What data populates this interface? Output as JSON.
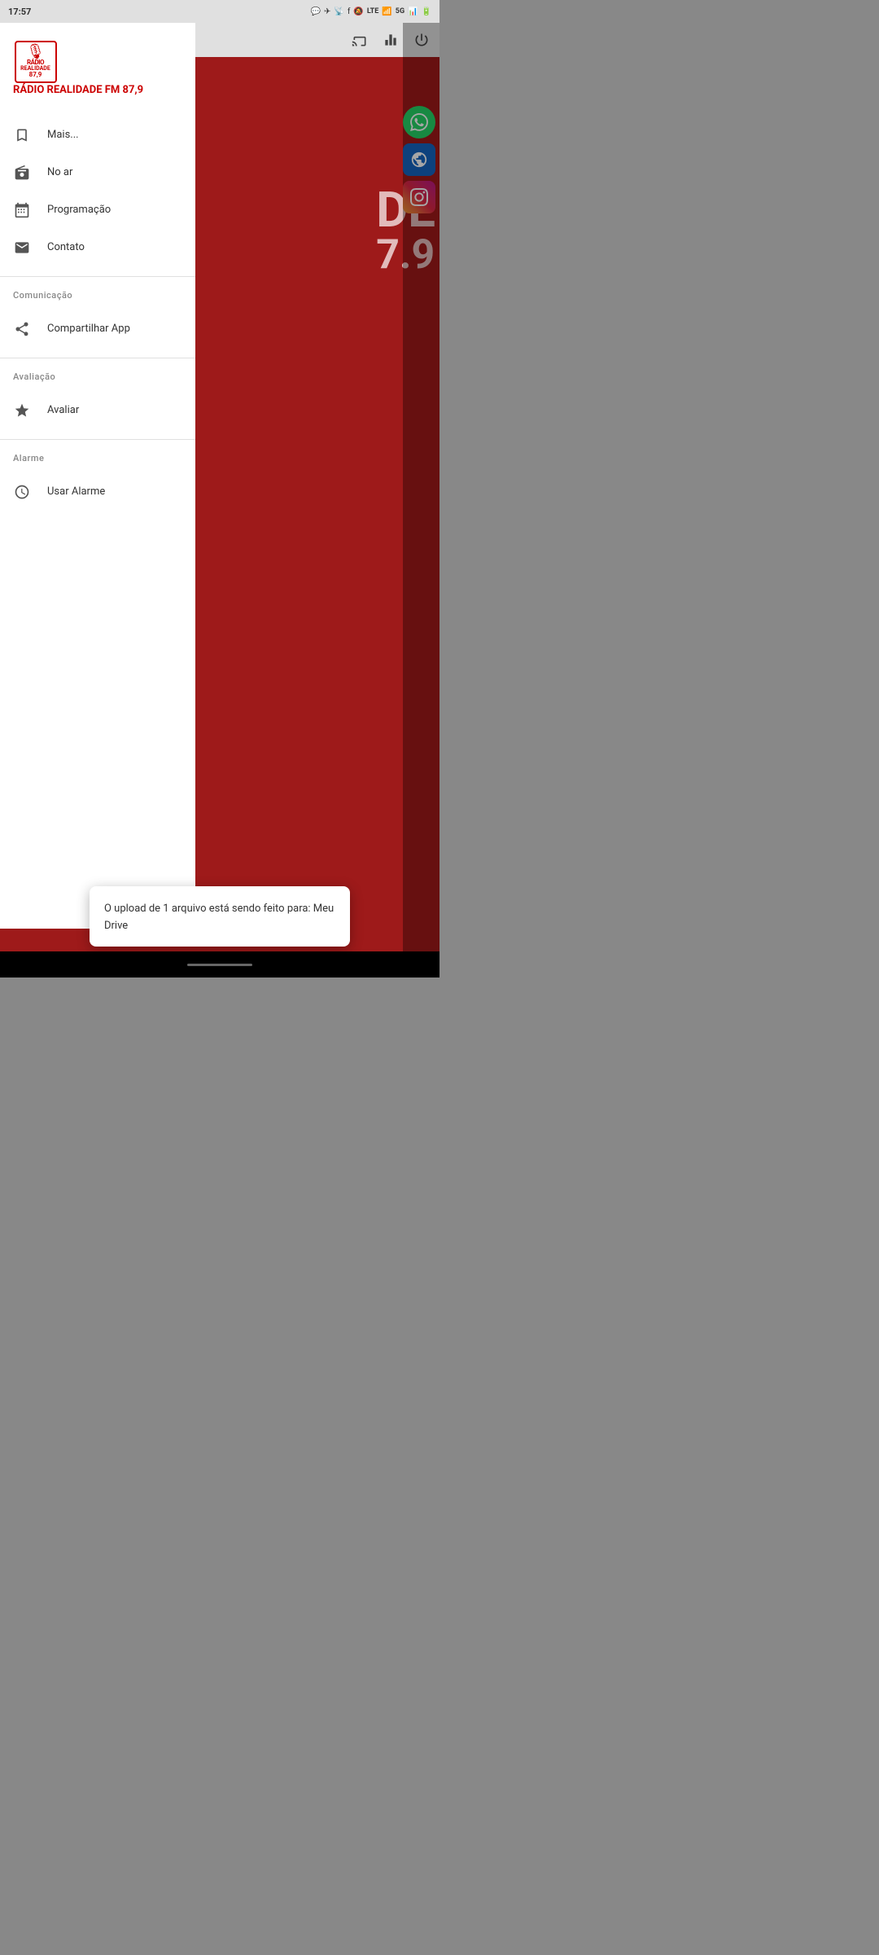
{
  "statusBar": {
    "time": "17:57",
    "icons": [
      "whatsapp-icon",
      "telegram-icon",
      "cast-icon",
      "facebook-icon",
      "dot-icon",
      "mute-icon",
      "lte-icon",
      "wifi-icon",
      "5g-icon",
      "signal-icon",
      "battery-icon"
    ]
  },
  "bgActionBar": {
    "icons": [
      "cast-icon",
      "equalizer-icon",
      "power-icon"
    ]
  },
  "drawer": {
    "logo": {
      "alt": "Rádio Realidade Logo"
    },
    "title": "RÁDIO REALIDADE FM 87,9",
    "menuItems": [
      {
        "id": "mais",
        "icon": "bookmark-icon",
        "label": "Mais..."
      },
      {
        "id": "no-ar",
        "icon": "radio-icon",
        "label": "No ar"
      },
      {
        "id": "programacao",
        "icon": "calendar-icon",
        "label": "Programação"
      },
      {
        "id": "contato",
        "icon": "mail-icon",
        "label": "Contato"
      }
    ],
    "sections": [
      {
        "title": "Comunicação",
        "items": [
          {
            "id": "compartilhar",
            "icon": "share-icon",
            "label": "Compartilhar App"
          }
        ]
      },
      {
        "title": "Avaliação",
        "items": [
          {
            "id": "avaliar",
            "icon": "star-icon",
            "label": "Avaliar"
          }
        ]
      },
      {
        "title": "Alarme",
        "items": [
          {
            "id": "usar-alarme",
            "icon": "alarm-icon",
            "label": "Usar Alarme"
          }
        ]
      }
    ]
  },
  "rightIcons": [
    {
      "id": "whatsapp",
      "symbol": "📱",
      "label": "WhatsApp"
    },
    {
      "id": "www",
      "symbol": "🌐",
      "label": "Website"
    },
    {
      "id": "instagram",
      "symbol": "📷",
      "label": "Instagram"
    }
  ],
  "toast": {
    "text": "O upload de 1 arquivo está sendo feito para: Meu Drive"
  },
  "bottomBar": {
    "homeIndicator": true
  }
}
